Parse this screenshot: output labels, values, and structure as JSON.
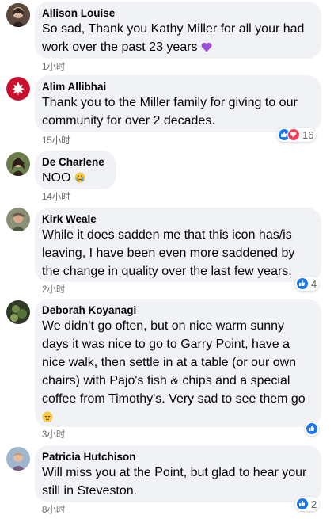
{
  "comments": [
    {
      "name": "Allison Louise",
      "text": "So sad, Thank you Kathy Miller for all your had work over the past 23 years",
      "emoji": "purple-heart",
      "time": "1小时"
    },
    {
      "name": "Alim Allibhai",
      "text": "Thank you to the Miller family for giving to our community for over 2 decades.",
      "time": "15小时",
      "reactions": {
        "count": "16",
        "types": [
          "like",
          "love"
        ]
      }
    },
    {
      "name": "De Charlene",
      "text": "NOO",
      "emoji": "crying-face",
      "time": "14小时"
    },
    {
      "name": "Kirk Weale",
      "text": "While it does sadden me that this icon has/is leaving, I have been even more saddened by the change in quality over the last few years.",
      "time": "2小时",
      "reactions": {
        "count": "4",
        "types": [
          "like"
        ]
      }
    },
    {
      "name": "Deborah Koyanagi",
      "text": "We didn't go often, but on nice warm sunny days it was nice to go to Garry Point, have a nice walk, then settle in at a table (or our own chairs) with Pajo's fish & chips and a special coffee from Timothy's. Very sad to see them go",
      "emoji": "pensive-face",
      "time": "3小时",
      "reactions": {
        "count": "",
        "types": [
          "like"
        ]
      }
    },
    {
      "name": "Patricia Hutchison",
      "text": "Will miss you at the Point, but glad to hear your still in Steveston.",
      "time": "8小时",
      "reactions": {
        "count": "2",
        "types": [
          "like"
        ]
      }
    }
  ],
  "colors": {
    "bubble": "#f0f2f5",
    "like": "#1877f2",
    "love": "#f33e58",
    "meta": "#65676b"
  }
}
